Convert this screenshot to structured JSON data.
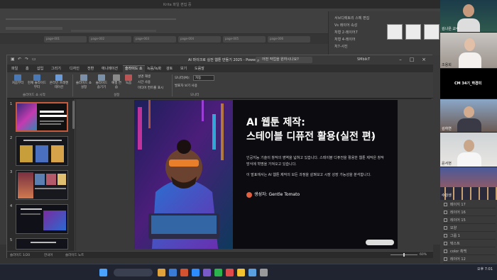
{
  "background_app": {
    "title": "Krita 파일 편집 중",
    "panel_rows": [
      "서브디렉토리 스펙 편집",
      "Vs 레이어 속성",
      "처형 2-레이어7",
      "처형 4-레이어",
      "처7-사진"
    ],
    "tabs": [
      "page-001",
      "page-002",
      "page-003",
      "page-004",
      "page-005",
      "page-006"
    ]
  },
  "layers_panel": {
    "rows": [
      "페이지 17",
      "레이어 16",
      "레이어 15",
      "모양",
      "그룹 1",
      "텍스트",
      "color 흑백",
      "레이어 12"
    ]
  },
  "powerpoint": {
    "document_title": "AI 마이크로 실전 웹툰 만들기 2025 - PowerPoint",
    "search_placeholder": "어떤 작업을 원하시나요?",
    "user": "SMbikT",
    "tabs": [
      "파일",
      "홈",
      "삽입",
      "그리기",
      "디자인",
      "전환",
      "애니메이션",
      "슬라이드 쇼",
      "녹음/녹화",
      "검토",
      "보기",
      "도움말"
    ],
    "active_tab": "슬라이드 쇼",
    "ribbon": {
      "buttons": [
        "처음부터",
        "현재 슬라이드부터",
        "온라인 프레젠테이션",
        "슬라이드 쇼 설정",
        "슬라이드 숨기기",
        "예행 연습",
        "녹음"
      ],
      "small_items": [
        "설명 재생",
        "시간 사용",
        "미디어 컨트롤 표시"
      ],
      "monitor_label": "모니터(M):",
      "monitor_value": "자동",
      "presenter_view": "발표자 보기 사용",
      "groups": [
        "슬라이드 쇼 시작",
        "설정",
        "모니터"
      ]
    },
    "slide": {
      "title_line1": "AI 웹툰 제작:",
      "title_line2": "스테이블 디퓨전 활용(실전 편)",
      "body_p1": "인공지능 기술이 창작의 영역을 넓혀고 있습니다. 스테이블 디퓨전을 활용한 웹툰 제작은 창작 방식에 혁명을 가져오고 있습니다.",
      "body_p2": "이 발표에서는 AI 웹툰 제작의 모든 과정을 살펴보고 시장 성장 가능성을 분석합니다.",
      "author": "생성자: Gentle Tomato"
    },
    "slide_numbers": [
      "1",
      "2",
      "3",
      "4",
      "5"
    ],
    "status": {
      "slide_count": "슬라이드 1/20",
      "language": "한국어",
      "notes": "슬라이드 노트",
      "zoom": "60%"
    }
  },
  "participants": [
    {
      "name": "김나은 교수"
    },
    {
      "name": "조용희"
    },
    {
      "name": "CM 34기_하경미"
    },
    {
      "name": "김하연"
    },
    {
      "name": "윤서현"
    },
    {
      "name": "수강생"
    }
  ],
  "taskbar": {
    "time": "오후 7:01",
    "date": "2025-06-17"
  }
}
